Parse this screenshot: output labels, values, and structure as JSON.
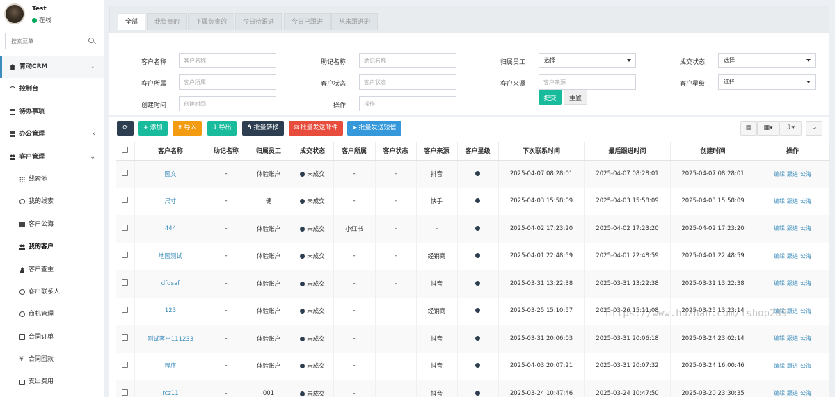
{
  "user": {
    "name": "Test",
    "status": "在线"
  },
  "sidebar": {
    "search_placeholder": "搜索菜单",
    "items": [
      {
        "label": "青动CRM",
        "icon": "home-icon",
        "level": "top",
        "arrow": "chevron-down"
      },
      {
        "label": "控制台",
        "icon": "dashboard-icon",
        "level": "main"
      },
      {
        "label": "待办事项",
        "icon": "calendar-icon",
        "level": "main"
      },
      {
        "label": "办公管理",
        "icon": "windows-icon",
        "level": "main",
        "arrow": "chevron-left"
      },
      {
        "label": "客户管理",
        "icon": "users-icon",
        "level": "main",
        "arrow": "chevron-down"
      },
      {
        "label": "线索池",
        "icon": "grid-icon",
        "level": "sub"
      },
      {
        "label": "我的线索",
        "icon": "search-icon",
        "level": "sub"
      },
      {
        "label": "客户公海",
        "icon": "map-icon",
        "level": "sub"
      },
      {
        "label": "我的客户",
        "icon": "users-icon",
        "level": "sub",
        "active": true
      },
      {
        "label": "客户查重",
        "icon": "user-card-icon",
        "level": "sub"
      },
      {
        "label": "客户联系人",
        "icon": "user-circle-icon",
        "level": "sub"
      },
      {
        "label": "商机管理",
        "icon": "circle-icon",
        "level": "sub"
      },
      {
        "label": "合同订单",
        "icon": "copy-icon",
        "level": "sub"
      },
      {
        "label": "合同回款",
        "icon": "yen-icon",
        "level": "sub"
      },
      {
        "label": "支出费用",
        "icon": "money-icon",
        "level": "sub"
      }
    ]
  },
  "tabs": [
    "全部",
    "我负责的",
    "下属负责的",
    "今日待跟进",
    "今日已跟进",
    "从未跟进的"
  ],
  "filters": {
    "customer_name": {
      "label": "客户名称",
      "placeholder": "客户名称"
    },
    "mnemonic": {
      "label": "助记名称",
      "placeholder": "助记名称"
    },
    "owner": {
      "label": "归属员工",
      "value": "选择"
    },
    "deal_status": {
      "label": "成交状态",
      "value": "选择"
    },
    "belong": {
      "label": "客户所属",
      "placeholder": "客户所属"
    },
    "cust_status": {
      "label": "客户状态",
      "placeholder": "客户状态"
    },
    "source": {
      "label": "客户来源",
      "placeholder": "客户来源"
    },
    "level": {
      "label": "客户星级",
      "value": "选择"
    },
    "created": {
      "label": "创建时间",
      "placeholder": "创建时间"
    },
    "operation": {
      "label": "操作",
      "placeholder": "操作"
    },
    "submit": "提交",
    "reset": "重置"
  },
  "toolbar": {
    "refresh_icon": "refresh-icon",
    "add": "添加",
    "import": "导入",
    "export": "导出",
    "transfer": "批量转移",
    "email": "批量发送邮件",
    "sms": "批量发送短信",
    "colors": {
      "refresh": "#2c3e50",
      "add": "#18bc9c",
      "import": "#f39c12",
      "export": "#18bc9c",
      "transfer": "#2c3e50",
      "email": "#e74c3c",
      "sms": "#3498db"
    }
  },
  "table": {
    "headers": [
      "客户名称",
      "助记名称",
      "归属员工",
      "成交状态",
      "客户所属",
      "客户状态",
      "客户来源",
      "客户星级",
      "下次联系时间",
      "最后跟进时间",
      "创建时间",
      "操作"
    ],
    "rows": [
      {
        "name": "图文",
        "mnemonic": "-",
        "owner": "体验账户",
        "deal": "未成交",
        "belong": "-",
        "status": "-",
        "source": "抖音",
        "next": "2025-04-07 08:28:01",
        "last": "2025-04-07 08:28:01",
        "created": "2025-04-07 08:28:01"
      },
      {
        "name": "尺寸",
        "mnemonic": "-",
        "owner": "健",
        "deal": "未成交",
        "belong": "-",
        "status": "-",
        "source": "快手",
        "next": "2025-04-03 15:58:09",
        "last": "2025-04-03 15:58:09",
        "created": "2025-04-03 15:58:09"
      },
      {
        "name": "444",
        "mnemonic": "-",
        "owner": "体验账户",
        "deal": "未成交",
        "belong": "小红书",
        "status": "-",
        "source": "-",
        "next": "2025-04-02 17:23:20",
        "last": "2025-04-02 17:23:20",
        "created": "2025-04-02 17:23:20"
      },
      {
        "name": "地图测试",
        "mnemonic": "-",
        "owner": "体验账户",
        "deal": "未成交",
        "belong": "-",
        "status": "-",
        "source": "经销商",
        "next": "2025-04-01 22:48:59",
        "last": "2025-04-01 22:48:59",
        "created": "2025-04-01 22:48:59"
      },
      {
        "name": "dfdsaf",
        "mnemonic": "-",
        "owner": "体验账户",
        "deal": "未成交",
        "belong": "-",
        "status": "-",
        "source": "抖音",
        "next": "2025-03-31 13:22:38",
        "last": "2025-03-31 13:22:38",
        "created": "2025-03-31 13:22:38"
      },
      {
        "name": "123",
        "mnemonic": "-",
        "owner": "体验账户",
        "deal": "未成交",
        "belong": "-",
        "status": "",
        "source": "经销商",
        "next": "2025-03-25 15:10:57",
        "last": "2025-03-26 15:11:08",
        "created": "2025-03-25 13:23:14"
      },
      {
        "name": "测试客户111233",
        "mnemonic": "-",
        "owner": "体验账户",
        "deal": "未成交",
        "belong": "-",
        "status": "",
        "source": "抖音",
        "next": "2025-03-31 20:06:03",
        "last": "2025-03-31 20:06:18",
        "created": "2025-03-24 23:02:14"
      },
      {
        "name": "程序",
        "mnemonic": "-",
        "owner": "体验账户",
        "deal": "未成交",
        "belong": "-",
        "status": "",
        "source": "抖音",
        "next": "2025-04-03 20:07:21",
        "last": "2025-03-31 20:07:32",
        "created": "2025-03-24 16:00:46"
      },
      {
        "name": "rcz11",
        "mnemonic": "-",
        "owner": "001",
        "deal": "未成交",
        "belong": "-",
        "status": "",
        "source": "抖音",
        "next": "2025-03-24 10:47:46",
        "last": "2025-03-24 10:47:50",
        "created": "2025-03-20 23:30:35"
      }
    ],
    "ops": [
      "编辑",
      "跟进",
      "公海"
    ]
  },
  "watermark": "https://www.huzhan.com/ishop289"
}
